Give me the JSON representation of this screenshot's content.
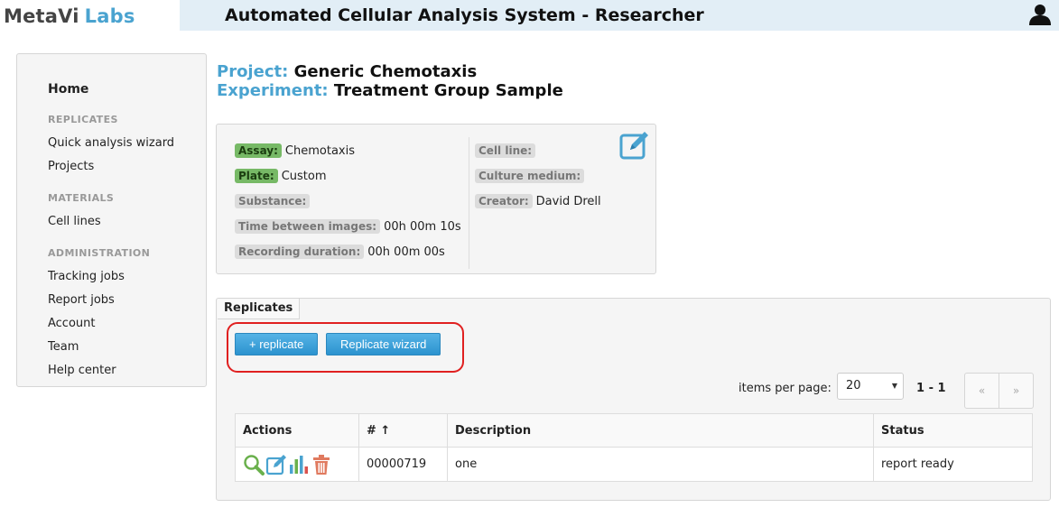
{
  "header": {
    "logo_part1": "MetaVi",
    "logo_part2": "Labs",
    "title": "Automated Cellular Analysis System - Researcher",
    "user_icon": "user-icon"
  },
  "sidebar": {
    "home": "Home",
    "section_replicates": "REPLICATES",
    "quick_wizard": "Quick analysis wizard",
    "projects": "Projects",
    "section_materials": "MATERIALS",
    "cell_lines": "Cell lines",
    "section_administration": "ADMINISTRATION",
    "tracking_jobs": "Tracking jobs",
    "report_jobs": "Report jobs",
    "account": "Account",
    "team": "Team",
    "help_center": "Help center"
  },
  "project": {
    "label": "Project:",
    "value": "Generic Chemotaxis"
  },
  "experiment": {
    "label": "Experiment:",
    "value": "Treatment Group Sample"
  },
  "info": {
    "assay_label": "Assay:",
    "assay_value": "Chemotaxis",
    "plate_label": "Plate:",
    "plate_value": "Custom",
    "substance_label": "Substance:",
    "substance_value": "",
    "time_label": "Time between images:",
    "time_value": "00h 00m 10s",
    "recording_label": "Recording duration:",
    "recording_value": "00h 00m 00s",
    "cell_line_label": "Cell line:",
    "cell_line_value": "",
    "culture_label": "Culture medium:",
    "culture_value": "",
    "creator_label": "Creator:",
    "creator_value": "David Drell"
  },
  "replicates": {
    "tab": "Replicates",
    "add_button": "+ replicate",
    "wizard_button": "Replicate wizard",
    "items_per_page_label": "items per page:",
    "items_per_page_value": "20",
    "range": "1 - 1",
    "prev": "«",
    "next": "»",
    "columns": {
      "actions": "Actions",
      "number": "# ↑",
      "description": "Description",
      "status": "Status"
    },
    "rows": [
      {
        "number": "00000719",
        "description": "one",
        "status": "report ready"
      }
    ]
  },
  "colors": {
    "accent_blue": "#4aa3d0",
    "header_bg": "#e2eef6",
    "badge_green": "#77b966",
    "highlight_red": "#e02020"
  }
}
